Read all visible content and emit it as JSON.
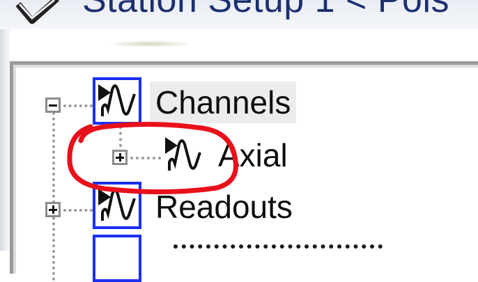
{
  "window": {
    "title": "Station Setup 1 < Pols"
  },
  "tree": {
    "nodes": [
      {
        "label": "Channels",
        "expander": "minus",
        "selected": true
      },
      {
        "label": "Axial",
        "expander": "plus",
        "selected": false
      },
      {
        "label": "Readouts",
        "expander": "plus",
        "selected": false
      }
    ]
  },
  "annotation": {
    "color": "#e8101a"
  }
}
